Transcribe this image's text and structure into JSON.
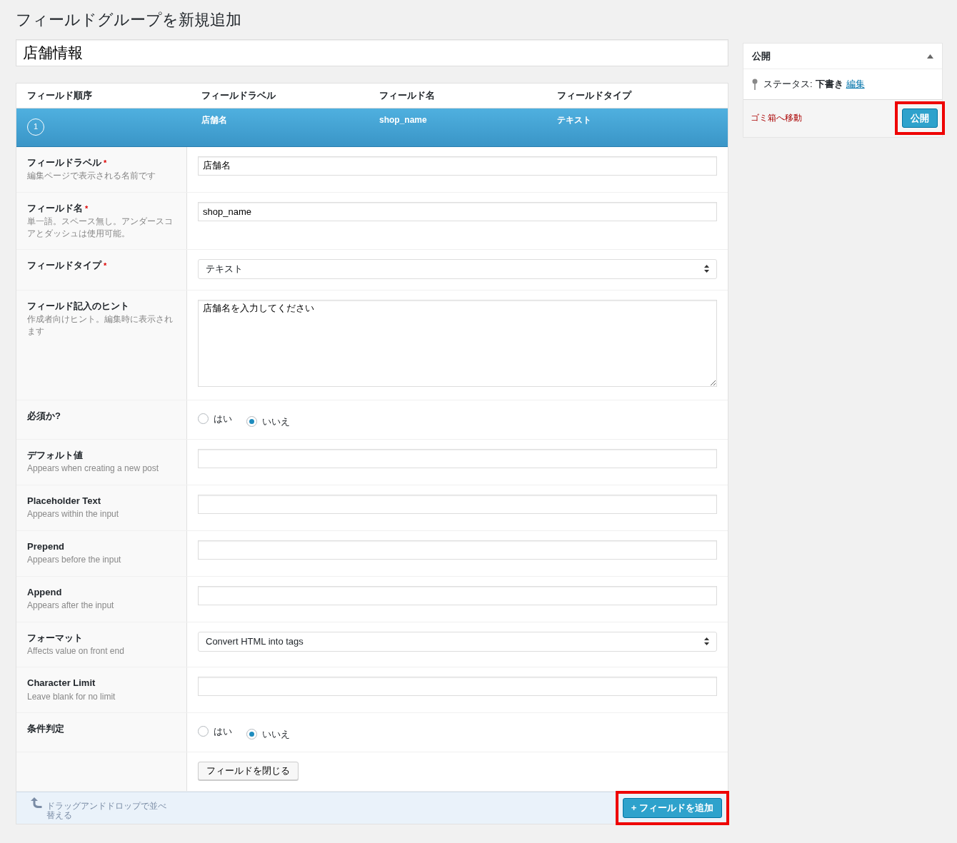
{
  "page_title": "フィールドグループを新規追加",
  "group_title": "店舗情報",
  "columns": [
    "フィールド順序",
    "フィールドラベル",
    "フィールド名",
    "フィールドタイプ"
  ],
  "field_row": {
    "order": "1",
    "label": "店舗名",
    "name": "shop_name",
    "type": "テキスト"
  },
  "settings": [
    {
      "kind": "text",
      "label": "フィールドラベル",
      "required": "*",
      "hint": "編集ページで表示される名前です",
      "value": "店舗名"
    },
    {
      "kind": "text",
      "label": "フィールド名",
      "required": "*",
      "hint": "単一語。スペース無し。アンダースコアとダッシュは使用可能。",
      "value": "shop_name"
    },
    {
      "kind": "select",
      "label": "フィールドタイプ",
      "required": "*",
      "value": "テキスト"
    },
    {
      "kind": "textarea",
      "label": "フィールド記入のヒント",
      "hint": "作成者向けヒント。編集時に表示されます",
      "value": "店舗名を入力してください"
    },
    {
      "kind": "radio",
      "label": "必須か?",
      "options": [
        {
          "label": "はい",
          "selected": false
        },
        {
          "label": "いいえ",
          "selected": true
        }
      ]
    },
    {
      "kind": "text",
      "label": "デフォルト値",
      "hint": "Appears when creating a new post"
    },
    {
      "kind": "text",
      "label": "Placeholder Text",
      "hint": "Appears within the input"
    },
    {
      "kind": "text",
      "label": "Prepend",
      "hint": "Appears before the input"
    },
    {
      "kind": "text",
      "label": "Append",
      "hint": "Appears after the input"
    },
    {
      "kind": "select",
      "label": "フォーマット",
      "hint": "Affects value on front end",
      "value": "Convert HTML into tags"
    },
    {
      "kind": "text",
      "label": "Character Limit",
      "hint": "Leave blank for no limit"
    },
    {
      "kind": "radio",
      "label": "条件判定",
      "options": [
        {
          "label": "はい",
          "selected": false
        },
        {
          "label": "いいえ",
          "selected": true
        }
      ]
    },
    {
      "kind": "button",
      "value": "フィールドを閉じる"
    }
  ],
  "footer": {
    "hint": "ドラッグアンドドロップで並べ替える",
    "add_button": {
      "label": "+ フィールドを追加",
      "highlighted": true
    }
  },
  "publish": {
    "title": "公開",
    "status_label": "ステータス:",
    "status_value": "下書き",
    "edit_link": "編集",
    "trash_link": "ゴミ箱へ移動",
    "button": {
      "label": "公開",
      "highlighted": true
    }
  }
}
